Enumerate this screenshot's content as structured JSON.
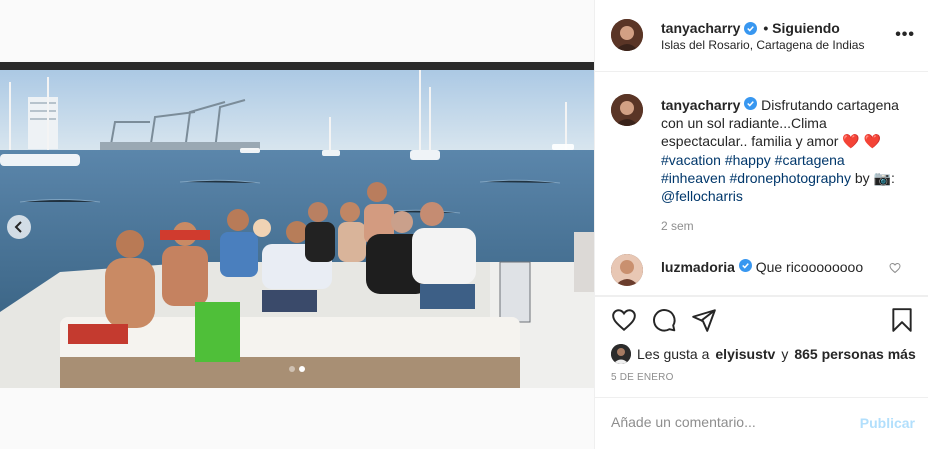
{
  "post": {
    "username": "tanyacharry",
    "follow_status": "• Siguiendo",
    "location": "Islas del Rosario, Cartagena de Indias",
    "more_icon": "more-icon"
  },
  "caption": {
    "username": "tanyacharry",
    "text_1": "Disfrutando cartagena con un sol radiante...Clima espectacular.. familia y amor",
    "hearts": "❤️ ❤️",
    "tags": [
      "#vacation",
      "#happy",
      "#cartagena",
      "#inheaven",
      "#dronephotography"
    ],
    "by_text": "by",
    "camera_icon": "📷",
    "colon": ":",
    "mention": "@fellocharris",
    "time": "2 sem"
  },
  "comment": {
    "username": "luzmadoria",
    "text": "Que ricoooooooo"
  },
  "likes": {
    "prefix": "Les gusta a",
    "user": "elyisustv",
    "conj": "y",
    "count": "865 personas más"
  },
  "date": "5 DE ENERO",
  "add_comment": {
    "placeholder": "Añade un comentario...",
    "publish_label": "Publicar"
  },
  "carousel": {
    "total_slides": 2,
    "active_slide": 1
  },
  "colors": {
    "verified": "#3897f0",
    "link": "#00376b",
    "publish_disabled": "#b2dffc",
    "muted": "#8e8e8e"
  }
}
